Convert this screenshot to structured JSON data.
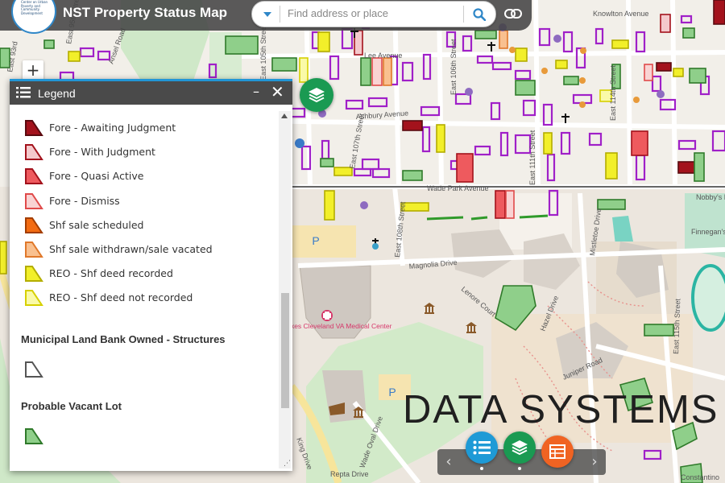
{
  "app": {
    "title": "NST Property Status Map",
    "logo_text": "Center on Urban Poverty and Community Development"
  },
  "search": {
    "placeholder": "Find address or place"
  },
  "map": {
    "zoom_in_label": "+",
    "street_labels": [
      "Lee Avenue",
      "Ashbury Avenue",
      "Wade Park Avenue",
      "Magnolia Drive",
      "East 105th Street",
      "East 107th Street",
      "East 108th Street",
      "East 106th Street",
      "East 111th Street",
      "East 114th Street",
      "East 115th Street",
      "Knowlton Avenue",
      "Lenore Court",
      "Hazel Drive",
      "Mistletoe Drive",
      "Juniper Road",
      "Finnegan's",
      "Nobby's Ballpark",
      "Wade Oval Drive",
      "King Drive",
      "Ansel Road",
      "East 95th Street",
      "East 93rd",
      "Repta Drive",
      "Constantino"
    ],
    "poi_label": "Louis Stokes Cleveland VA Medical Center",
    "parking_label": "P",
    "watermark": "DATA SYSTEMS"
  },
  "legend": {
    "title": "Legend",
    "minimize_label": "–",
    "close_label": "✕",
    "items": [
      {
        "label": "Fore - Awaiting Judgment",
        "fill": "#a3121c",
        "stroke": "#5a0a0f"
      },
      {
        "label": "Fore - With Judgment",
        "fill": "#f4c9cc",
        "stroke": "#a3121c"
      },
      {
        "label": "Fore - Quasi Active",
        "fill": "#ee5a5e",
        "stroke": "#a3121c"
      },
      {
        "label": "Fore - Dismiss",
        "fill": "#f9d3d3",
        "stroke": "#e04a4a"
      },
      {
        "label": "Shf sale scheduled",
        "fill": "#f26b12",
        "stroke": "#a33d00"
      },
      {
        "label": "Shf sale withdrawn/sale vacated",
        "fill": "#f9c08f",
        "stroke": "#e0782a"
      },
      {
        "label": "REO - Shf deed recorded",
        "fill": "#f2ef2a",
        "stroke": "#b3ad00"
      },
      {
        "label": "REO - Shf deed not recorded",
        "fill": "#fafaa8",
        "stroke": "#d6d000"
      }
    ],
    "groups": [
      {
        "label": "Municipal Land Bank Owned - Structures",
        "fill": "#ffffff",
        "stroke": "#555555"
      },
      {
        "label": "Probable Vacant Lot",
        "fill": "#8fcf8a",
        "stroke": "#2f7a2a"
      }
    ]
  },
  "controller": {
    "prev_label": "‹",
    "next_label": "›"
  },
  "colors": {
    "header_bg": "#444444",
    "accent_blue": "#1e9ad6",
    "accent_green": "#1a9a52",
    "accent_orange": "#f06322",
    "parcel_purple": "#a020c8"
  },
  "icons": [
    "list-icon",
    "layers-icon",
    "search-icon",
    "link-icon",
    "chevron-down-icon",
    "table-icon",
    "close-icon",
    "minimize-icon",
    "museum-icon",
    "church-cross-icon",
    "hospital-icon",
    "parking-icon",
    "university-icon"
  ]
}
